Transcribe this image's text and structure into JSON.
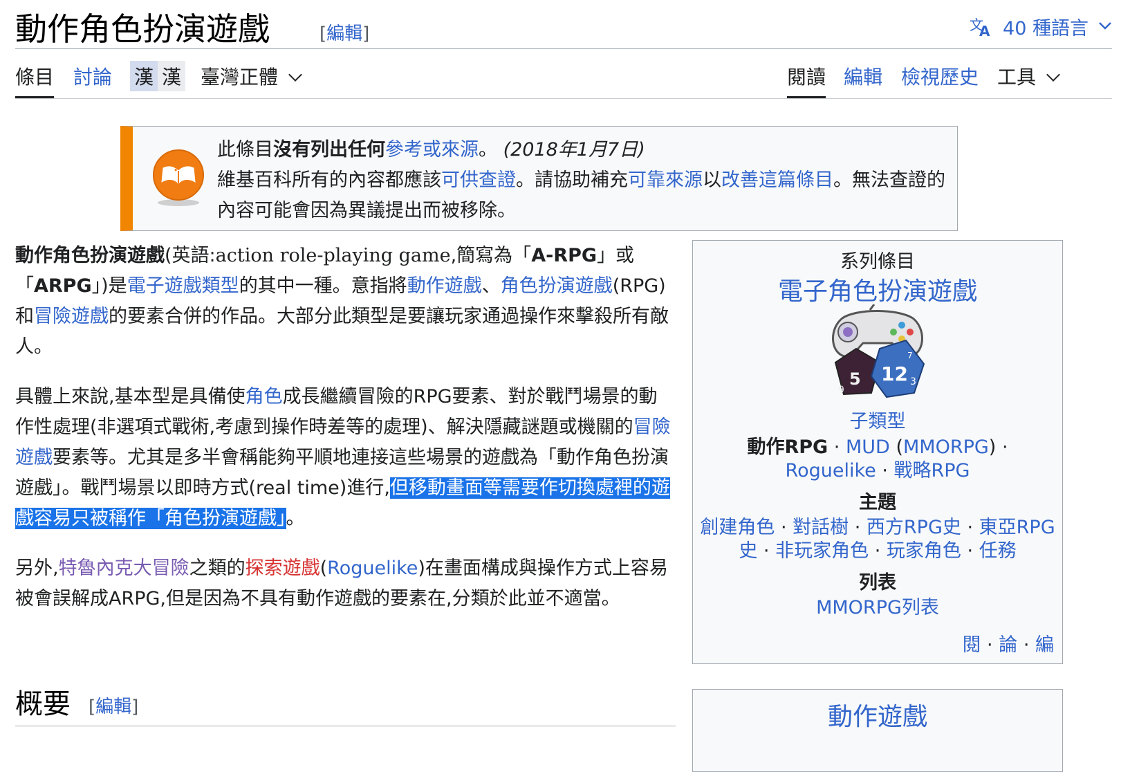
{
  "header": {
    "title": "動作角色扮演遊戲",
    "edit_open": "[",
    "edit_label": "編輯",
    "edit_close": "]",
    "languages_label": "40 種語言"
  },
  "tabs": {
    "article": "條目",
    "talk": "討論",
    "hanzi_a": "漢",
    "hanzi_b": "漢",
    "variant": "臺灣正體",
    "read": "閱讀",
    "edit": "編輯",
    "history": "檢視歷史",
    "tools": "工具"
  },
  "notice": {
    "t1": "此條目",
    "t1b": "沒有列出任何",
    "t1link": "參考或來源",
    "t1end": "。",
    "date": "(2018年1月7日)",
    "t2": "維基百科所有的內容都應該",
    "t2link1": "可供查證",
    "t2b": "。請協助補充",
    "t2link2": "可靠來源",
    "t2c": "以",
    "t2link3": "改善這篇條目",
    "t2d": "。無法查證的內容可能會因為異議提出而被移除。"
  },
  "article": {
    "p1": {
      "bold1": "動作角色扮演遊戲",
      "a": "(英語:",
      "en": "action role-playing game",
      "b": ",簡寫為「",
      "bold2": "A-RPG",
      "c": "」或「",
      "bold3": "ARPG",
      "d": "」)是",
      "l1": "電子遊戲類型",
      "e": "的其中一種。意指將",
      "l2": "動作遊戲",
      "f": "、",
      "l3": "角色扮演遊戲",
      "g": "(RPG)和",
      "l4": "冒險遊戲",
      "h": "的要素合併的作品。大部分此類型是要讓玩家通過操作來擊殺所有敵人。"
    },
    "p2": {
      "a": "具體上來說,基本型是具備使",
      "l1": "角色",
      "b": "成長繼續冒險的RPG要素、對於戰鬥場景的動作性處理(非選項式戰術,考慮到操作時差等的處理)、解決隱藏謎題或機關的",
      "l2": "冒險遊戲",
      "c": "要素等。尤其是多半會稱能夠平順地連接這些場景的遊戲為「動作角色扮演遊戲」。戰鬥場景以即時方式(real time)進行,",
      "sel": "但移動畫面等需要作切換處裡的遊戲容易只被稱作「角色扮演遊戲」",
      "d": "。"
    },
    "p3": {
      "a": "另外,",
      "l1": "特魯內克大冒險",
      "b": "之類的",
      "l2": "探索遊戲",
      "c": "(",
      "l3": "Roguelike",
      "d": ")在畫面構成與操作方式上容易被會誤解成ARPG,但是因為不具有動作遊戲的要素在,分類於此並不適當。"
    },
    "section": {
      "title": "概要",
      "edit_open": "[",
      "edit_label": "編輯",
      "edit_close": "]"
    }
  },
  "navbox": {
    "series": "系列條目",
    "title": "電子角色扮演遊戲",
    "subgenres_head": "子類型",
    "sub1": "動作RPG",
    "sub2": "MUD",
    "sub3": "MMORPG",
    "sub4": "Roguelike",
    "sub5": "戰略RPG",
    "topics_head": "主題",
    "top1": "創建角色",
    "top2": "對話樹",
    "top3": "西方RPG史",
    "top4": "東亞RPG史",
    "top5": "非玩家角色",
    "top6": "玩家角色",
    "top7": "任務",
    "lists_head": "列表",
    "list1": "MMORPG列表",
    "f1": "閱",
    "f2": "論",
    "f3": "編",
    "sep": "·",
    "paren_open": "(",
    "paren_close": ")"
  },
  "navbox2": {
    "title": "動作遊戲"
  },
  "colors": {
    "link": "#3366cc",
    "red_link": "#d73333",
    "visited_link": "#795cb2",
    "notice_accent": "#f28500",
    "selection": "#1a73e8"
  },
  "icons": [
    "translate-icon",
    "chevron-down-icon",
    "book-question-icon",
    "gamepad-dice-icon"
  ]
}
